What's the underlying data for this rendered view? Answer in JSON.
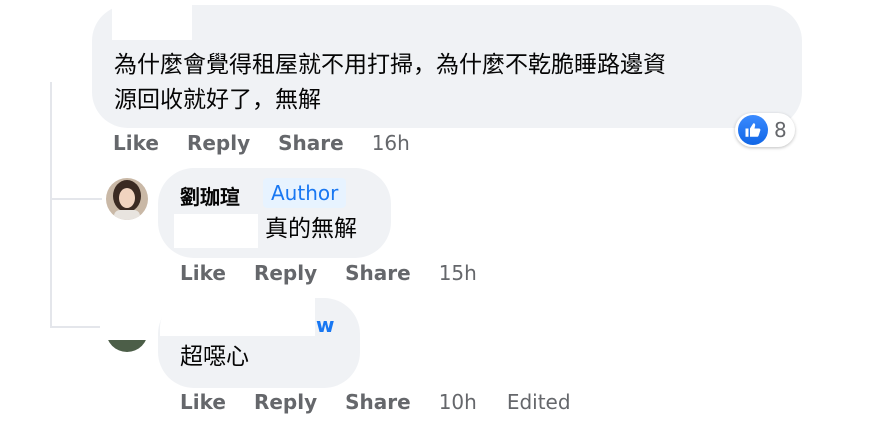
{
  "comment_main": {
    "text_line1": "為什麼會覺得租屋就不用打掃，為什麼不乾脆睡路邊資",
    "text_line2": "源回收就好了，無解",
    "reactions": {
      "icon": "like-icon",
      "count": "8"
    },
    "actions": {
      "like": "Like",
      "reply": "Reply",
      "share": "Share",
      "time": "16h"
    }
  },
  "reply_author": {
    "name": "劉珈瑄",
    "badge": "Author",
    "text": "真的無解",
    "actions": {
      "like": "Like",
      "reply": "Reply",
      "share": "Share",
      "time": "15h"
    }
  },
  "reply_second": {
    "name_fragment": "w",
    "text": "超噁心",
    "actions": {
      "like": "Like",
      "reply": "Reply",
      "share": "Share",
      "time": "10h",
      "edited": "Edited"
    }
  },
  "colors": {
    "bubble": "#f0f2f5",
    "meta_text": "#65676b",
    "link_blue": "#1877f2",
    "badge_bg": "#e7f3ff"
  }
}
